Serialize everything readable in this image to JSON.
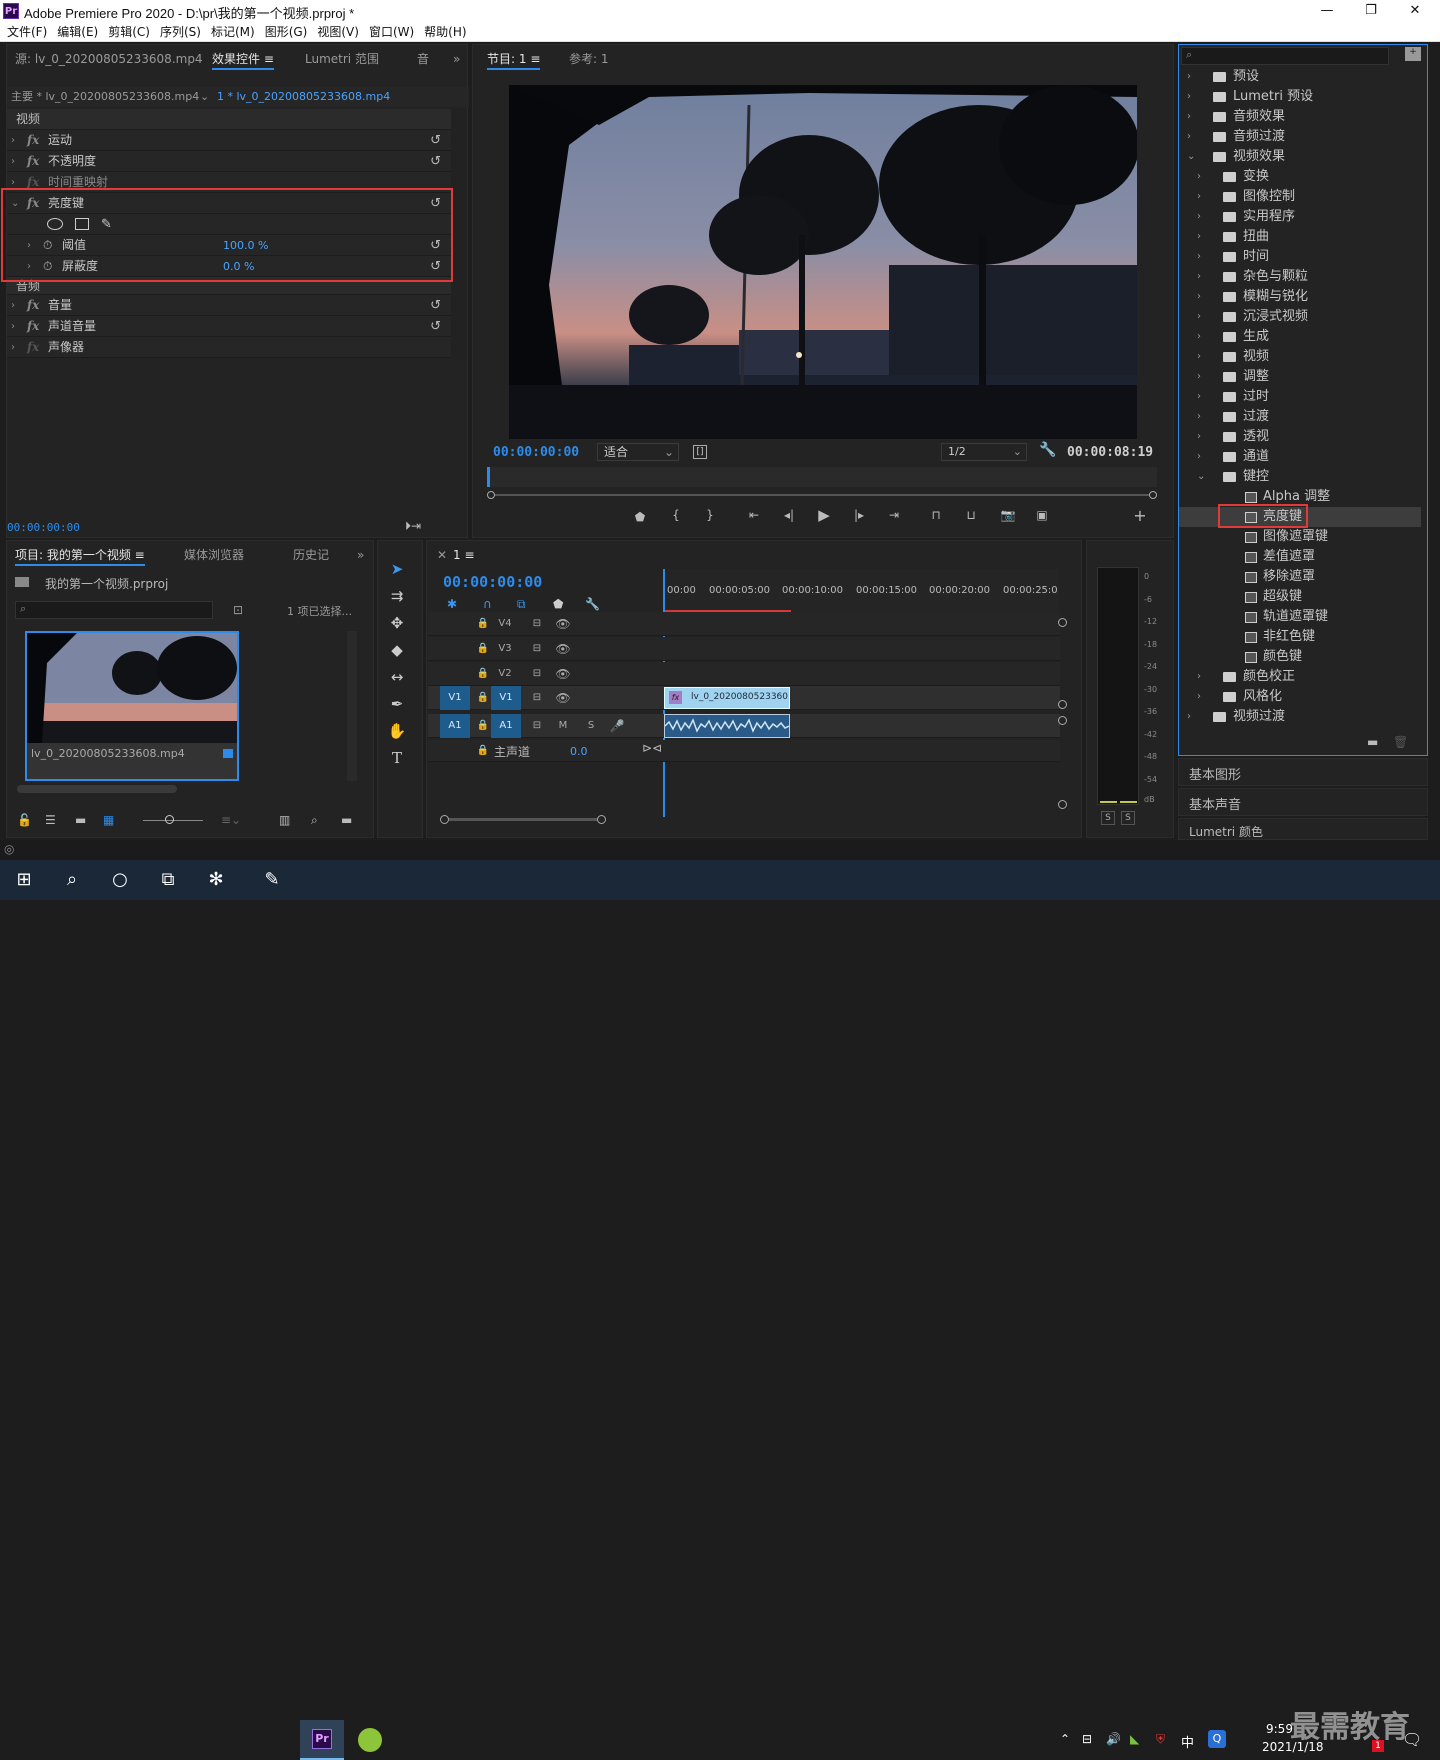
{
  "window": {
    "title": "Adobe Premiere Pro 2020 - D:\\pr\\我的第一个视频.prproj *",
    "logo": "Pr",
    "controls": [
      "—",
      "❐",
      "✕"
    ]
  },
  "menu": [
    "文件(F)",
    "编辑(E)",
    "剪辑(C)",
    "序列(S)",
    "标记(M)",
    "图形(G)",
    "视图(V)",
    "窗口(W)",
    "帮助(H)"
  ],
  "effect_controls": {
    "tabs": [
      "源: lv_0_20200805233608.mp4",
      "效果控件",
      "Lumetri 范围",
      "音"
    ],
    "master_clip": "主要 * lv_0_20200805233608.mp4",
    "sequence_clip": "1 * lv_0_20200805233608.mp4",
    "video_header": "视频",
    "rows": [
      {
        "label": "运动"
      },
      {
        "label": "不透明度"
      },
      {
        "label": "时间重映射"
      },
      {
        "label": "亮度键"
      }
    ],
    "params": [
      {
        "label": "阈值",
        "value": "100.0 %"
      },
      {
        "label": "屏蔽度",
        "value": "0.0 %"
      }
    ],
    "audio_header": "音频",
    "audio_rows": [
      {
        "label": "音量"
      },
      {
        "label": "声道音量"
      },
      {
        "label": "声像器"
      }
    ],
    "timecode": "00:00:00:00"
  },
  "program_monitor": {
    "tabs": [
      "节目: 1",
      "参考: 1"
    ],
    "timecode_in": "00:00:00:00",
    "fit": "适合",
    "resolution": "1/2",
    "timecode_out": "00:00:08:19"
  },
  "project": {
    "tabs": [
      "项目: 我的第一个视频",
      "媒体浏览器",
      "历史记"
    ],
    "project_file": "我的第一个视频.prproj",
    "selection": "1 项已选择...",
    "clip_name": "lv_0_20200805233608.mp4"
  },
  "timeline": {
    "tab": "1",
    "timecode": "00:00:00:00",
    "ruler": [
      "00:00",
      "00:00:05:00",
      "00:00:10:00",
      "00:00:15:00",
      "00:00:20:00",
      "00:00:25:0"
    ],
    "tracks": [
      {
        "name": "V4"
      },
      {
        "name": "V3"
      },
      {
        "name": "V2"
      },
      {
        "name": "V1",
        "source": "V1"
      },
      {
        "name": "A1",
        "source": "A1"
      }
    ],
    "master": "主声道",
    "master_value": "0.0",
    "video_clip": "lv_0_20200805233608.mp4",
    "video_clip_label": "lv_0_2020080523360",
    "audio_clip_badge": "fx",
    "mute": "M",
    "solo": "S"
  },
  "audio_meter": {
    "scale": [
      "0",
      "-6",
      "-12",
      "-18",
      "-24",
      "-30",
      "-36",
      "-42",
      "-48",
      "-54",
      "dB"
    ],
    "solo": [
      "S",
      "S"
    ]
  },
  "effects_panel": {
    "tree": [
      {
        "label": "预设",
        "depth": 0,
        "type": "bin"
      },
      {
        "label": "Lumetri 预设",
        "depth": 0,
        "type": "bin"
      },
      {
        "label": "音频效果",
        "depth": 0,
        "type": "folder"
      },
      {
        "label": "音频过渡",
        "depth": 0,
        "type": "folder"
      },
      {
        "label": "视频效果",
        "depth": 0,
        "type": "folder",
        "open": true
      },
      {
        "label": "变换",
        "depth": 1,
        "type": "folder"
      },
      {
        "label": "图像控制",
        "depth": 1,
        "type": "folder"
      },
      {
        "label": "实用程序",
        "depth": 1,
        "type": "folder"
      },
      {
        "label": "扭曲",
        "depth": 1,
        "type": "folder"
      },
      {
        "label": "时间",
        "depth": 1,
        "type": "folder"
      },
      {
        "label": "杂色与颗粒",
        "depth": 1,
        "type": "folder"
      },
      {
        "label": "模糊与锐化",
        "depth": 1,
        "type": "folder"
      },
      {
        "label": "沉浸式视频",
        "depth": 1,
        "type": "folder"
      },
      {
        "label": "生成",
        "depth": 1,
        "type": "folder"
      },
      {
        "label": "视频",
        "depth": 1,
        "type": "folder"
      },
      {
        "label": "调整",
        "depth": 1,
        "type": "folder"
      },
      {
        "label": "过时",
        "depth": 1,
        "type": "folder"
      },
      {
        "label": "过渡",
        "depth": 1,
        "type": "folder"
      },
      {
        "label": "透视",
        "depth": 1,
        "type": "folder"
      },
      {
        "label": "通道",
        "depth": 1,
        "type": "folder"
      },
      {
        "label": "键控",
        "depth": 1,
        "type": "folder",
        "open": true
      },
      {
        "label": "Alpha 调整",
        "depth": 2,
        "type": "effect"
      },
      {
        "label": "亮度键",
        "depth": 2,
        "type": "effect",
        "selected": true
      },
      {
        "label": "图像遮罩键",
        "depth": 2,
        "type": "effect"
      },
      {
        "label": "差值遮罩",
        "depth": 2,
        "type": "effect"
      },
      {
        "label": "移除遮罩",
        "depth": 2,
        "type": "effect"
      },
      {
        "label": "超级键",
        "depth": 2,
        "type": "effect"
      },
      {
        "label": "轨道遮罩键",
        "depth": 2,
        "type": "effect"
      },
      {
        "label": "非红色键",
        "depth": 2,
        "type": "effect"
      },
      {
        "label": "颜色键",
        "depth": 2,
        "type": "effect"
      },
      {
        "label": "颜色校正",
        "depth": 1,
        "type": "folder"
      },
      {
        "label": "风格化",
        "depth": 1,
        "type": "folder"
      },
      {
        "label": "视频过渡",
        "depth": 0,
        "type": "folder"
      }
    ],
    "collapsed_panels": [
      "基本图形",
      "基本声音",
      "Lumetri 颜色"
    ]
  },
  "taskbar": {
    "time": "9:59",
    "date": "2021/1/18",
    "ime": "中",
    "notification_count": "1",
    "watermark": "最需教育"
  },
  "colors": {
    "accent": "#2d8ceb",
    "highlight_box": "#e03a3a",
    "track_blue": "#1f5c8e",
    "clip_video": "#9fd3f0"
  }
}
